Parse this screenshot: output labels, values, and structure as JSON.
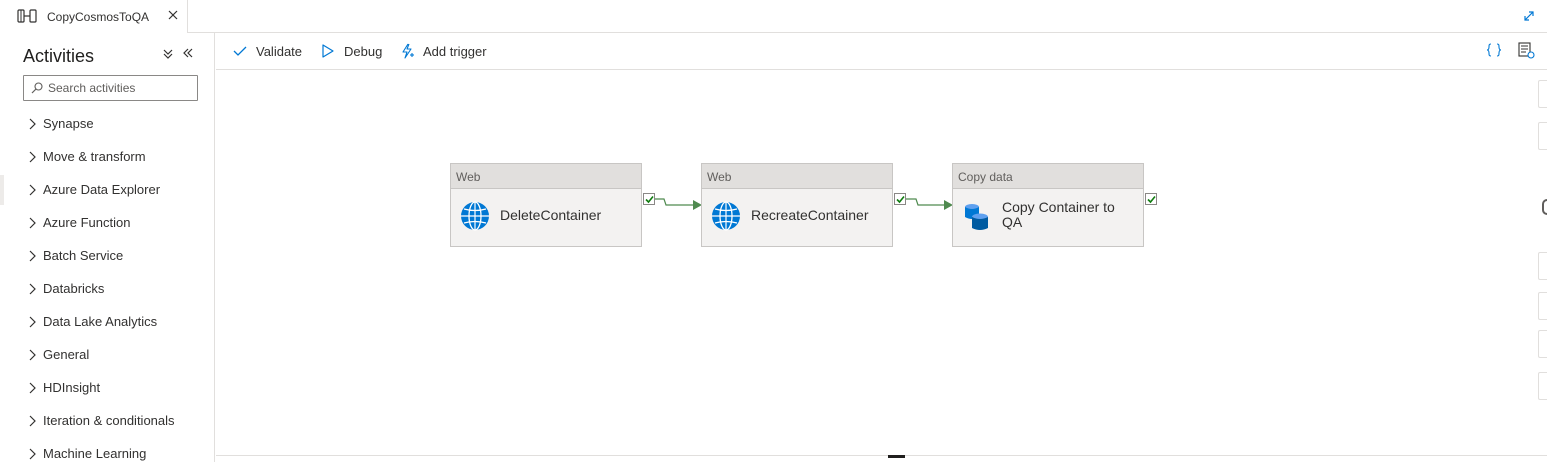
{
  "tab": {
    "title": "CopyCosmosToQA"
  },
  "sidebar": {
    "title": "Activities",
    "search_placeholder": "Search activities",
    "categories": [
      {
        "label": "Synapse"
      },
      {
        "label": "Move & transform"
      },
      {
        "label": "Azure Data Explorer"
      },
      {
        "label": "Azure Function"
      },
      {
        "label": "Batch Service"
      },
      {
        "label": "Databricks"
      },
      {
        "label": "Data Lake Analytics"
      },
      {
        "label": "General"
      },
      {
        "label": "HDInsight"
      },
      {
        "label": "Iteration & conditionals"
      },
      {
        "label": "Machine Learning"
      }
    ]
  },
  "toolbar": {
    "validate_label": "Validate",
    "debug_label": "Debug",
    "add_trigger_label": "Add trigger"
  },
  "pipeline": {
    "activities": [
      {
        "type": "Web",
        "name": "DeleteContainer",
        "icon": "globe-icon"
      },
      {
        "type": "Web",
        "name": "RecreateContainer",
        "icon": "globe-icon"
      },
      {
        "type": "Copy data",
        "name": "Copy Container to QA",
        "icon": "copy-data-icon"
      }
    ]
  },
  "colors": {
    "accent": "#0078d4",
    "success": "#107c10",
    "connector": "#4f8a4f",
    "node_header": "#e1dfdd",
    "node_body": "#f3f2f1"
  }
}
